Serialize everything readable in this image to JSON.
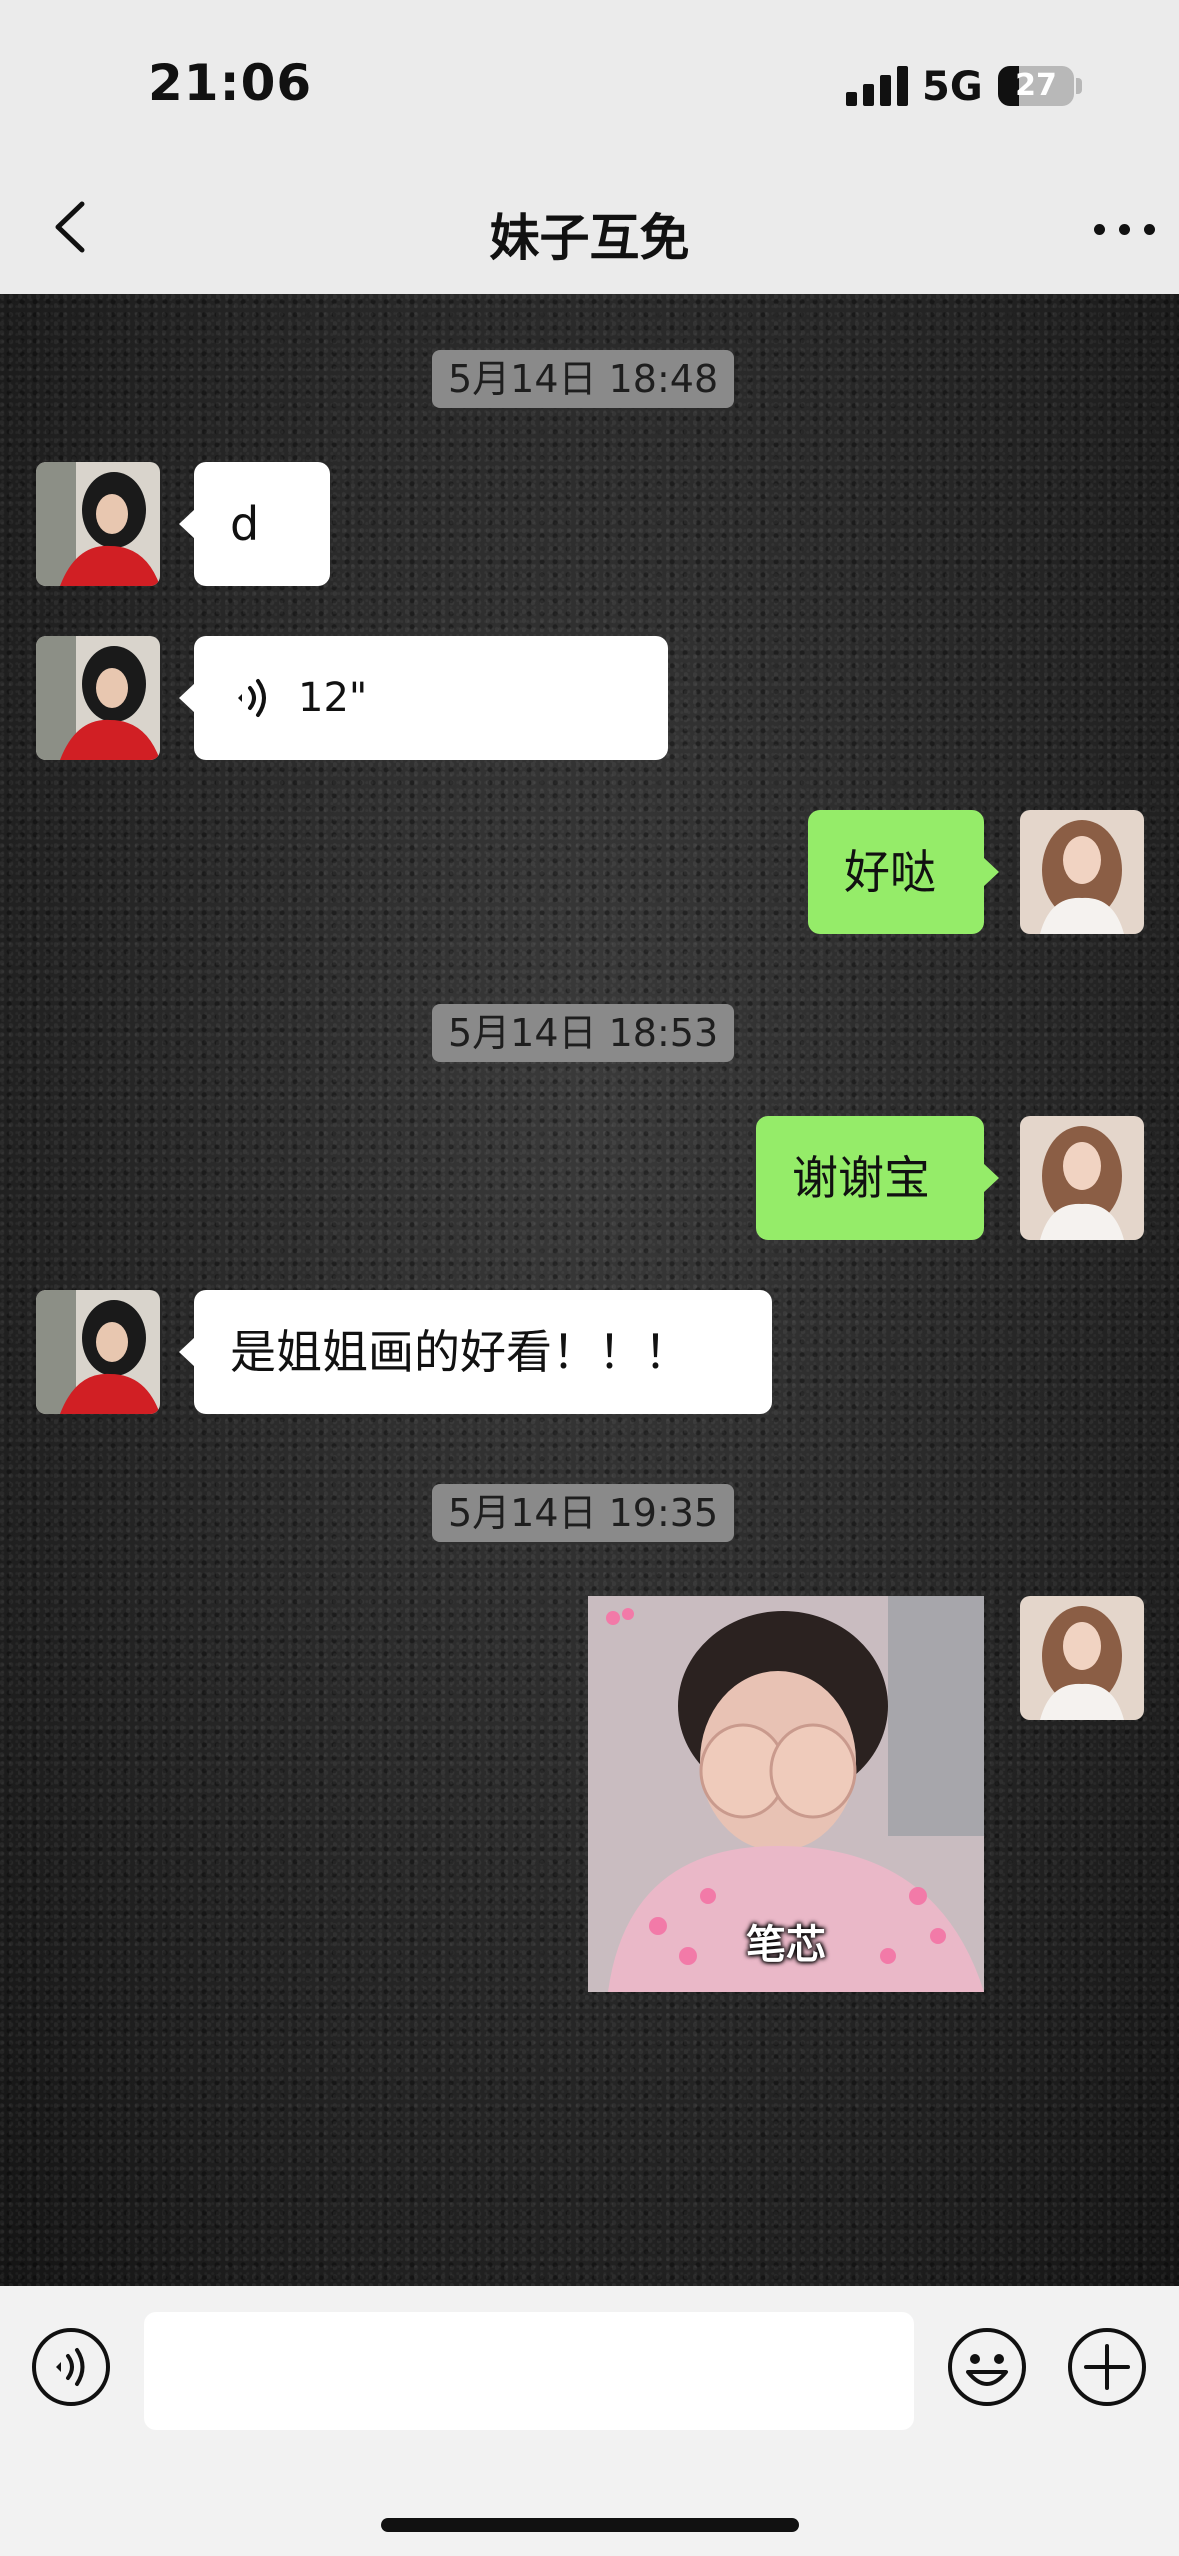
{
  "status_bar": {
    "time": "21:06",
    "network": "5G",
    "battery": "27",
    "battery_level": 0.27
  },
  "header": {
    "title": "妹子互免",
    "back_icon": "chevron-left-icon",
    "more_icon": "ellipsis-icon"
  },
  "messages": [
    {
      "kind": "timestamp",
      "text": "5月14日 18:48"
    },
    {
      "kind": "text",
      "side": "left",
      "text": "d"
    },
    {
      "kind": "voice",
      "side": "left",
      "duration": "12\""
    },
    {
      "kind": "text",
      "side": "right",
      "text": "好哒"
    },
    {
      "kind": "timestamp",
      "text": "5月14日 18:53"
    },
    {
      "kind": "text",
      "side": "right",
      "text": "谢谢宝"
    },
    {
      "kind": "text",
      "side": "left",
      "text": "是姐姐画的好看！！！"
    },
    {
      "kind": "timestamp",
      "text": "5月14日 19:35"
    },
    {
      "kind": "sticker",
      "side": "right",
      "caption": "笔芯"
    }
  ],
  "input_bar": {
    "voice_icon": "voice-icon",
    "input_value": "",
    "emoji_icon": "emoji-icon",
    "plus_icon": "plus-icon"
  },
  "colors": {
    "outgoing_bubble": "#95ec69",
    "incoming_bubble": "#ffffff",
    "timestamp_bg": "#8a8a8a",
    "chrome_bg": "#ebebeb"
  }
}
